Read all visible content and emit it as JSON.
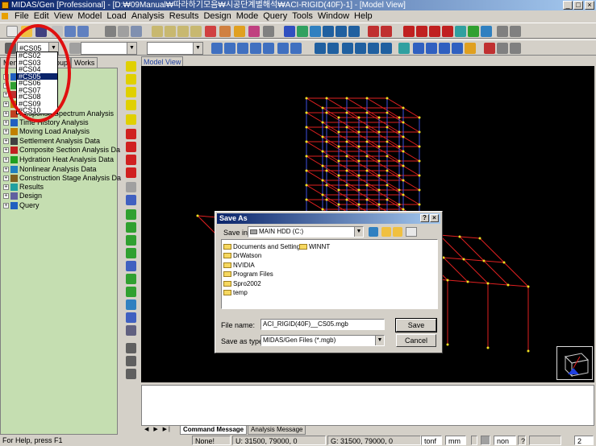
{
  "window": {
    "title": "MIDAS/Gen [Professional] - [D:₩09Manual₩따라하기모음₩시공단계별해석₩ACI-RIGID(40F)-1] - [Model View]",
    "controls": [
      "_",
      "□",
      "×"
    ]
  },
  "menu": [
    "File",
    "Edit",
    "View",
    "Model",
    "Load",
    "Analysis",
    "Results",
    "Design",
    "Mode",
    "Query",
    "Tools",
    "Window",
    "Help"
  ],
  "stage_combo": {
    "value": "#CS05",
    "options": [
      "#CS02",
      "#CS03",
      "#CS04",
      "#CS05",
      "#CS06",
      "#CS07",
      "#CS08",
      "#CS09",
      "#CS10"
    ],
    "selected_index": 3
  },
  "panel_tabs": [
    "Men",
    "Group",
    "Works"
  ],
  "tree": [
    {
      "label": "Response Spectrum Analysis",
      "color": "#c04020"
    },
    {
      "label": "Time History Analysis",
      "color": "#2060c0"
    },
    {
      "label": "Moving Load Analysis",
      "color": "#c08000"
    },
    {
      "label": "Settlement Analysis Data",
      "color": "#404040"
    },
    {
      "label": "Composite Section Analysis Da",
      "color": "#c02020"
    },
    {
      "label": "Hydration Heat Analysis Data",
      "color": "#20a020"
    },
    {
      "label": "Nonlinear Analysis Data",
      "color": "#2080c0"
    },
    {
      "label": "Construction Stage Analysis Da",
      "color": "#806020"
    },
    {
      "label": "Results",
      "color": "#20a0a0"
    },
    {
      "label": "Design",
      "color": "#6060a0"
    },
    {
      "label": "Query",
      "color": "#2060c0"
    }
  ],
  "view_tab": "Model View",
  "dialog": {
    "title": "Save As",
    "help": "?",
    "close": "×",
    "save_in_label": "Save in:",
    "save_in_value": "MAIN HDD (C:)",
    "folders": [
      "Documents and Settings",
      "DrWatson",
      "NVIDIA",
      "Program Files",
      "Spro2002",
      "temp",
      "WINNT"
    ],
    "filename_label": "File name:",
    "filename_value": "ACI_RIGID(40F)__CS05.mgb",
    "filetype_label": "Save as type:",
    "filetype_value": "MIDAS/Gen Files (*.mgb)",
    "save_button": "Save",
    "cancel_button": "Cancel"
  },
  "message_tabs": [
    "Command Message",
    "Analysis Message"
  ],
  "status": {
    "help": "For Help, press F1",
    "sel": "None!",
    "u": "U: 31500, 79000, 0",
    "g": "G: 31500, 79000, 0",
    "force_unit": "tonf",
    "length_unit": "mm",
    "mode": "non",
    "page": "2"
  },
  "colors": {
    "title_blue": "#0a246a",
    "tree_bg": "#c5deb1",
    "frame_red": "#e02020",
    "frame_blue": "#4050e0",
    "node_yellow": "#f0e020",
    "highlight_circle": "#e01010"
  }
}
